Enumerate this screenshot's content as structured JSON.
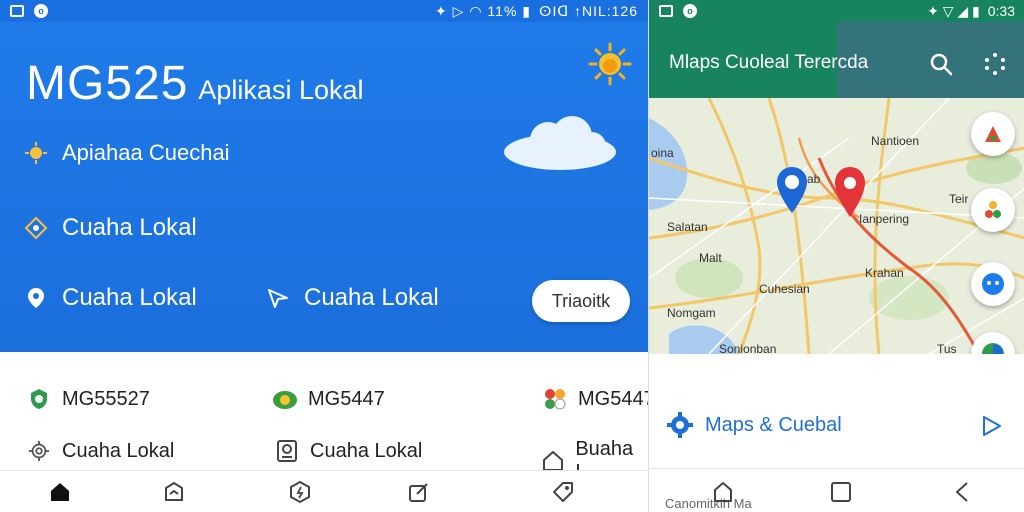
{
  "left": {
    "status": {
      "right_text": "ⵙIᗡ ↑NIL:126"
    },
    "hero": {
      "title": "MG525",
      "subtitle": "Aplikasi Lokal",
      "row1": "Apiahaa Cuechai",
      "row2": "Cuaha Lokal",
      "row3": "Cuaha Lokal",
      "row4": "Cuaha Lokal",
      "pill": "Triaoitk"
    },
    "grid": {
      "items": [
        {
          "label": "MG55527"
        },
        {
          "label": "MG5447"
        },
        {
          "label": "MG5447"
        },
        {
          "label": "Cuaha Lokal"
        },
        {
          "label": "Cuaha Lokal"
        },
        {
          "label": "Buaha L"
        }
      ]
    }
  },
  "right": {
    "status": {
      "time": "0:33"
    },
    "appbar": {
      "title": "Mlaps Cuoleal Terercda"
    },
    "map_labels": [
      "oina",
      "Sab",
      "Nantioen",
      "Teir",
      "Salatan",
      "Ianpering",
      "Malt",
      "Krahan",
      "Cuhesian",
      "Nomgam",
      "Sonionban",
      "Tus"
    ],
    "action_label": "Maps & Cuebal",
    "sysnav_caption": "Canomitkih Ma"
  },
  "colors": {
    "left_blue": "#1b6fdc",
    "right_green": "#17835f",
    "link_blue": "#1f6fd6"
  }
}
